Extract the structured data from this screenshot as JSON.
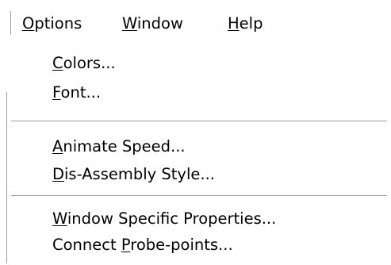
{
  "menubar": {
    "items": [
      {
        "mnemonic": "O",
        "rest": "ptions"
      },
      {
        "mnemonic": "W",
        "rest": "indow"
      },
      {
        "mnemonic": "H",
        "rest": "elp"
      }
    ]
  },
  "dropdown": {
    "groups": [
      [
        {
          "pre": "",
          "mnemonic": "C",
          "rest": "olors..."
        },
        {
          "pre": "",
          "mnemonic": "F",
          "rest": "ont..."
        }
      ],
      [
        {
          "pre": "",
          "mnemonic": "A",
          "rest": "nimate Speed..."
        },
        {
          "pre": "",
          "mnemonic": "D",
          "rest": "is-Assembly Style..."
        }
      ],
      [
        {
          "pre": "",
          "mnemonic": "W",
          "rest": "indow Specific Properties..."
        },
        {
          "pre": "Connect ",
          "mnemonic": "P",
          "rest": "robe-points..."
        }
      ]
    ]
  }
}
